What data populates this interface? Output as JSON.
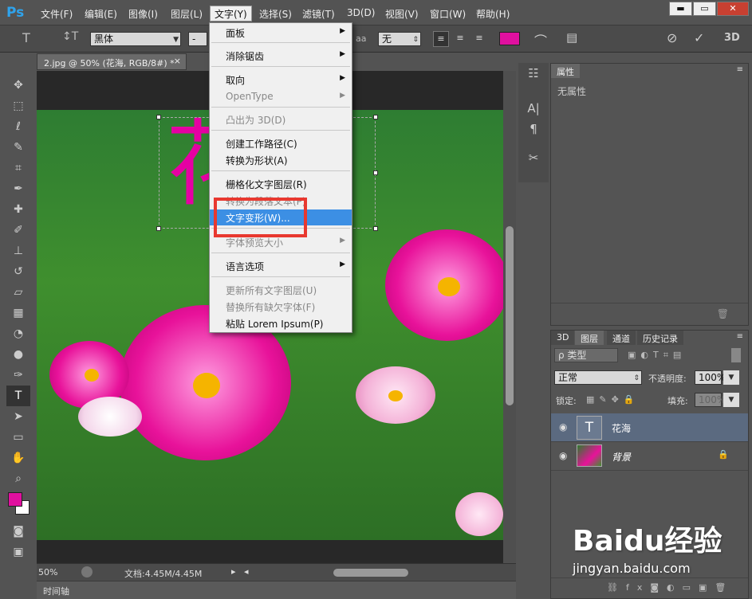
{
  "app": {
    "logo": "Ps"
  },
  "menubar": {
    "items": [
      "文件(F)",
      "编辑(E)",
      "图像(I)",
      "图层(L)",
      "文字(Y)",
      "选择(S)",
      "滤镜(T)",
      "3D(D)",
      "视图(V)",
      "窗口(W)",
      "帮助(H)"
    ],
    "active": "文字(Y)"
  },
  "window_buttons": {
    "min": "▬",
    "max": "▭",
    "close": "✕"
  },
  "options": {
    "font_family": "黑体",
    "aa_label": "aa",
    "aa_value": "无",
    "dash": "-"
  },
  "document": {
    "tab_title": "2.jpg @ 50% (花海, RGB/8#) *",
    "tab_close": "×",
    "type_text": "花海"
  },
  "status": {
    "zoom": "50%",
    "doc_info": "文档:4.45M/4.45M"
  },
  "timeline": {
    "label": "时间轴"
  },
  "properties": {
    "tab": "属性",
    "empty": "无属性"
  },
  "layers_panel": {
    "tabs": [
      "3D",
      "图层",
      "通道",
      "历史记录"
    ],
    "filter_label": "ρ 类型",
    "blend_mode": "正常",
    "opacity_label": "不透明度:",
    "opacity_value": "100%",
    "lock_label": "锁定:",
    "fill_label": "填充:",
    "fill_value": "100%",
    "layers": [
      {
        "name": "花海",
        "type": "text"
      },
      {
        "name": "背景",
        "type": "image"
      }
    ]
  },
  "dropdown": {
    "items": [
      {
        "label": "面板",
        "submenu": true
      },
      {
        "label": "消除锯齿",
        "submenu": true
      },
      {
        "label": "取向",
        "submenu": true
      },
      {
        "label": "OpenType",
        "submenu": true,
        "disabled": true
      },
      {
        "label": "凸出为 3D(D)",
        "disabled": true
      },
      {
        "label": "创建工作路径(C)"
      },
      {
        "label": "转换为形状(A)"
      },
      {
        "label": "栅格化文字图层(R)"
      },
      {
        "label": "转换为段落文本(P)",
        "disabled": true
      },
      {
        "label": "文字变形(W)...",
        "highlighted": true
      },
      {
        "label": "字体预览大小",
        "submenu": true,
        "disabled": true
      },
      {
        "label": "语言选项",
        "submenu": true
      },
      {
        "label": "更新所有文字图层(U)",
        "disabled": true
      },
      {
        "label": "替换所有缺欠字体(F)",
        "disabled": true
      },
      {
        "label": "粘贴 Lorem Ipsum(P)"
      }
    ]
  },
  "watermark": {
    "brand": "Baidu经验",
    "url": "jingyan.baidu.com"
  },
  "colors": {
    "foreground": "#e0109f",
    "background": "#ffffff",
    "accent": "#3c8fe4",
    "highlight_box": "#e8382f"
  }
}
